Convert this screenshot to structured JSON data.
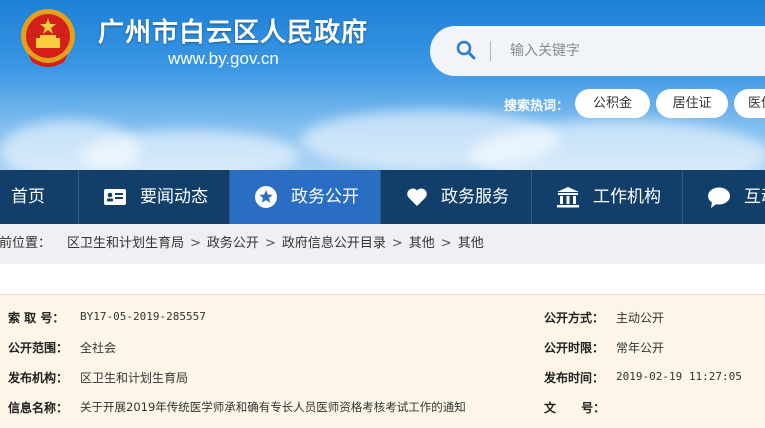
{
  "header": {
    "site_title": "广州市白云区人民政府",
    "site_url": "www.by.gov.cn",
    "search": {
      "placeholder": "输入关键字"
    },
    "hot_label": "搜索热词：",
    "hot_tags": [
      "公积金",
      "居住证",
      "医保"
    ]
  },
  "nav": {
    "items": [
      {
        "label": "首页",
        "icon": ""
      },
      {
        "label": "要闻动态",
        "icon": "news-card-icon"
      },
      {
        "label": "政务公开",
        "icon": "star-badge-icon",
        "active": true
      },
      {
        "label": "政务服务",
        "icon": "heart-icon"
      },
      {
        "label": "工作机构",
        "icon": "building-icon"
      },
      {
        "label": "互动交流",
        "icon": "chat-bubble-icon"
      }
    ]
  },
  "breadcrumb": {
    "prefix": "当前位置：",
    "items": [
      "区卫生和计划生育局",
      "政务公开",
      "政府信息公开目录",
      "其他",
      "其他"
    ],
    "separator": ">"
  },
  "info": {
    "index_no_label": "索  取  号：",
    "index_no": "BY17-05-2019-285557",
    "open_mode_label": "公开方式：",
    "open_mode": "主动公开",
    "scope_label": "公开范围：",
    "scope": "全社会",
    "open_time_label": "公开时限：",
    "open_time": "常年公开",
    "publisher_label": "发布机构：",
    "publisher": "区卫生和计划生育局",
    "publish_time_label": "发布时间：",
    "publish_time": "2019-02-19 11:27:05",
    "name_label": "信息名称：",
    "name": "关于开展2019年传统医学师承和确有专长人员医师资格考核考试工作的通知",
    "doc_no_label": "文      号：",
    "doc_no": ""
  },
  "colors": {
    "nav_bg": "#123f69",
    "nav_active": "#2a6ec4",
    "info_bg": "#fdf6e8"
  }
}
